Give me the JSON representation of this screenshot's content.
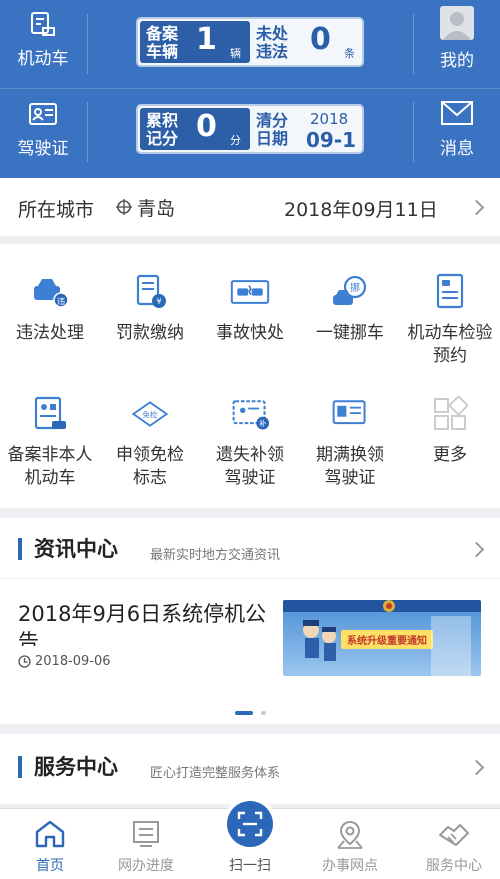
{
  "header": {
    "vehicle_label": "机动车",
    "license_label": "驾驶证",
    "mine_label": "我的",
    "message_label": "消息",
    "panel1": {
      "left_key": "备案\n车辆",
      "left_value": "1",
      "left_unit": "辆",
      "right_key": "未处\n违法",
      "right_value": "0",
      "right_unit": "条"
    },
    "panel2": {
      "left_key": "累积\n记分",
      "left_value": "0",
      "left_unit": "分",
      "right_key": "清分\n日期",
      "right_year": "2018",
      "right_date": "09-1"
    }
  },
  "citybar": {
    "city_label": "所在城市",
    "city_name": "青岛",
    "date": "2018年09月11日"
  },
  "grid": {
    "items": [
      {
        "label": "违法处理"
      },
      {
        "label": "罚款缴纳"
      },
      {
        "label": "事故快处"
      },
      {
        "label": "一键挪车"
      },
      {
        "label": "机动车检验预约"
      },
      {
        "label": "备案非本人机动车"
      },
      {
        "label": "申领免检标志"
      },
      {
        "label": "遗失补领驾驶证"
      },
      {
        "label": "期满换领驾驶证"
      },
      {
        "label": "更多"
      }
    ],
    "icon_badges": {
      "exempt": "免检",
      "move": "挪",
      "fix": "补",
      "fine": "¥"
    }
  },
  "news": {
    "title": "资讯中心",
    "subtitle": "最新实时地方交通资讯",
    "article_title": "2018年9月6日系统停机公告",
    "article_date": "2018-09-06",
    "thumb_text": "系统升级重要通知"
  },
  "service": {
    "title": "服务中心",
    "subtitle": "匠心打造完整服务体系"
  },
  "bottomnav": {
    "items": [
      {
        "label": "首页"
      },
      {
        "label": "网办进度"
      },
      {
        "label": "扫一扫"
      },
      {
        "label": "办事网点"
      },
      {
        "label": "服务中心"
      }
    ]
  },
  "colors": {
    "primary": "#3a73c2",
    "accent": "#2c68b8",
    "active_nav": "#2c68b8",
    "inactive_nav": "#999999"
  }
}
